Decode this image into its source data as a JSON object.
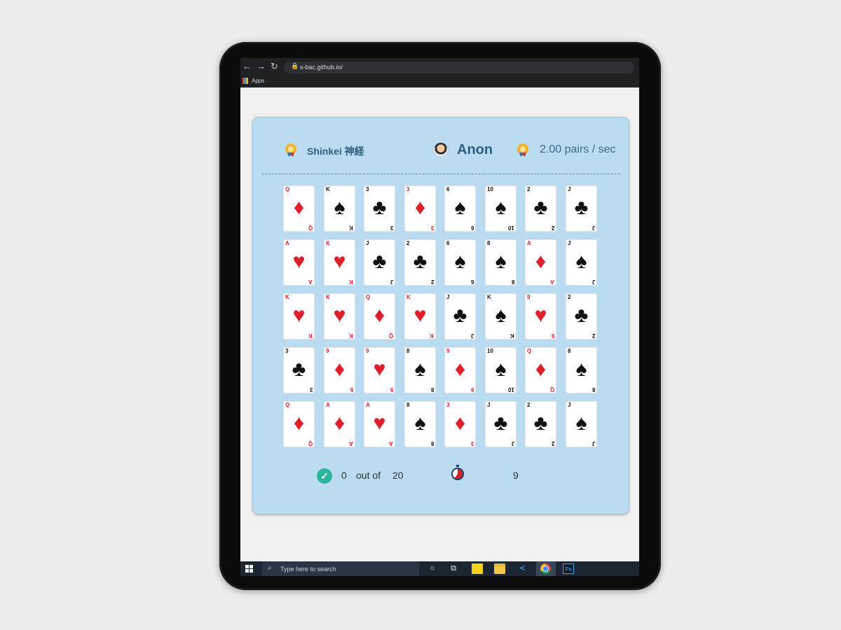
{
  "browser": {
    "url": "s-bac.github.io/",
    "bookmarks": {
      "apps_label": "Apps"
    },
    "icons": {
      "back": "←",
      "forward": "→",
      "reload": "↻",
      "lock": "🔒"
    }
  },
  "game": {
    "title": "Shinkei 神経",
    "player_name": "Anon",
    "speed": "2.00 pairs / sec",
    "grid": {
      "columns": 8,
      "rows": [
        [
          {
            "rank": "Q",
            "suit": "♦",
            "color": "red"
          },
          {
            "rank": "K",
            "suit": "♠",
            "color": "black"
          },
          {
            "rank": "3",
            "suit": "♣",
            "color": "black"
          },
          {
            "rank": "3",
            "suit": "♦",
            "color": "red"
          },
          {
            "rank": "6",
            "suit": "♠",
            "color": "black"
          },
          {
            "rank": "10",
            "suit": "♠",
            "color": "black"
          },
          {
            "rank": "2",
            "suit": "♣",
            "color": "black"
          },
          {
            "rank": "J",
            "suit": "♣",
            "color": "black"
          }
        ],
        [
          {
            "rank": "A",
            "suit": "♥",
            "color": "red"
          },
          {
            "rank": "K",
            "suit": "♥",
            "color": "red"
          },
          {
            "rank": "J",
            "suit": "♣",
            "color": "black"
          },
          {
            "rank": "2",
            "suit": "♣",
            "color": "black"
          },
          {
            "rank": "6",
            "suit": "♠",
            "color": "black"
          },
          {
            "rank": "8",
            "suit": "♠",
            "color": "black"
          },
          {
            "rank": "A",
            "suit": "♦",
            "color": "red"
          },
          {
            "rank": "J",
            "suit": "♠",
            "color": "black"
          }
        ],
        [
          {
            "rank": "K",
            "suit": "♥",
            "color": "red"
          },
          {
            "rank": "K",
            "suit": "♥",
            "color": "red"
          },
          {
            "rank": "Q",
            "suit": "♦",
            "color": "red"
          },
          {
            "rank": "K",
            "suit": "♥",
            "color": "red"
          },
          {
            "rank": "J",
            "suit": "♣",
            "color": "black"
          },
          {
            "rank": "K",
            "suit": "♠",
            "color": "black"
          },
          {
            "rank": "9",
            "suit": "♥",
            "color": "red"
          },
          {
            "rank": "2",
            "suit": "♣",
            "color": "black"
          }
        ],
        [
          {
            "rank": "3",
            "suit": "♣",
            "color": "black"
          },
          {
            "rank": "9",
            "suit": "♦",
            "color": "red"
          },
          {
            "rank": "9",
            "suit": "♥",
            "color": "red"
          },
          {
            "rank": "8",
            "suit": "♠",
            "color": "black"
          },
          {
            "rank": "9",
            "suit": "♦",
            "color": "red"
          },
          {
            "rank": "10",
            "suit": "♠",
            "color": "black"
          },
          {
            "rank": "Q",
            "suit": "♦",
            "color": "red"
          },
          {
            "rank": "8",
            "suit": "♠",
            "color": "black"
          }
        ],
        [
          {
            "rank": "Q",
            "suit": "♦",
            "color": "red"
          },
          {
            "rank": "A",
            "suit": "♦",
            "color": "red"
          },
          {
            "rank": "A",
            "suit": "♥",
            "color": "red"
          },
          {
            "rank": "8",
            "suit": "♠",
            "color": "black"
          },
          {
            "rank": "3",
            "suit": "♦",
            "color": "red"
          },
          {
            "rank": "J",
            "suit": "♣",
            "color": "black"
          },
          {
            "rank": "2",
            "suit": "♣",
            "color": "black"
          },
          {
            "rank": "J",
            "suit": "♠",
            "color": "black"
          }
        ]
      ]
    },
    "footer": {
      "check_glyph": "✓",
      "matched": "0",
      "out_of_label": "out of",
      "total": "20",
      "elapsed": "9",
      "timer_fraction": 0.6
    }
  },
  "taskbar": {
    "search_placeholder": "Type here to search",
    "search_glyph": "⌕",
    "cortana_glyph": "○",
    "taskview_glyph": "⧉",
    "vscode_glyph": "≺",
    "ps_label": "Ps"
  },
  "colors": {
    "panel_bg": "#bbdcf0",
    "title_text": "#2d5f80",
    "card_red": "#e01f2d",
    "card_black": "#111111",
    "check_green": "#2bb59a",
    "timer_red": "#e01f2d"
  }
}
